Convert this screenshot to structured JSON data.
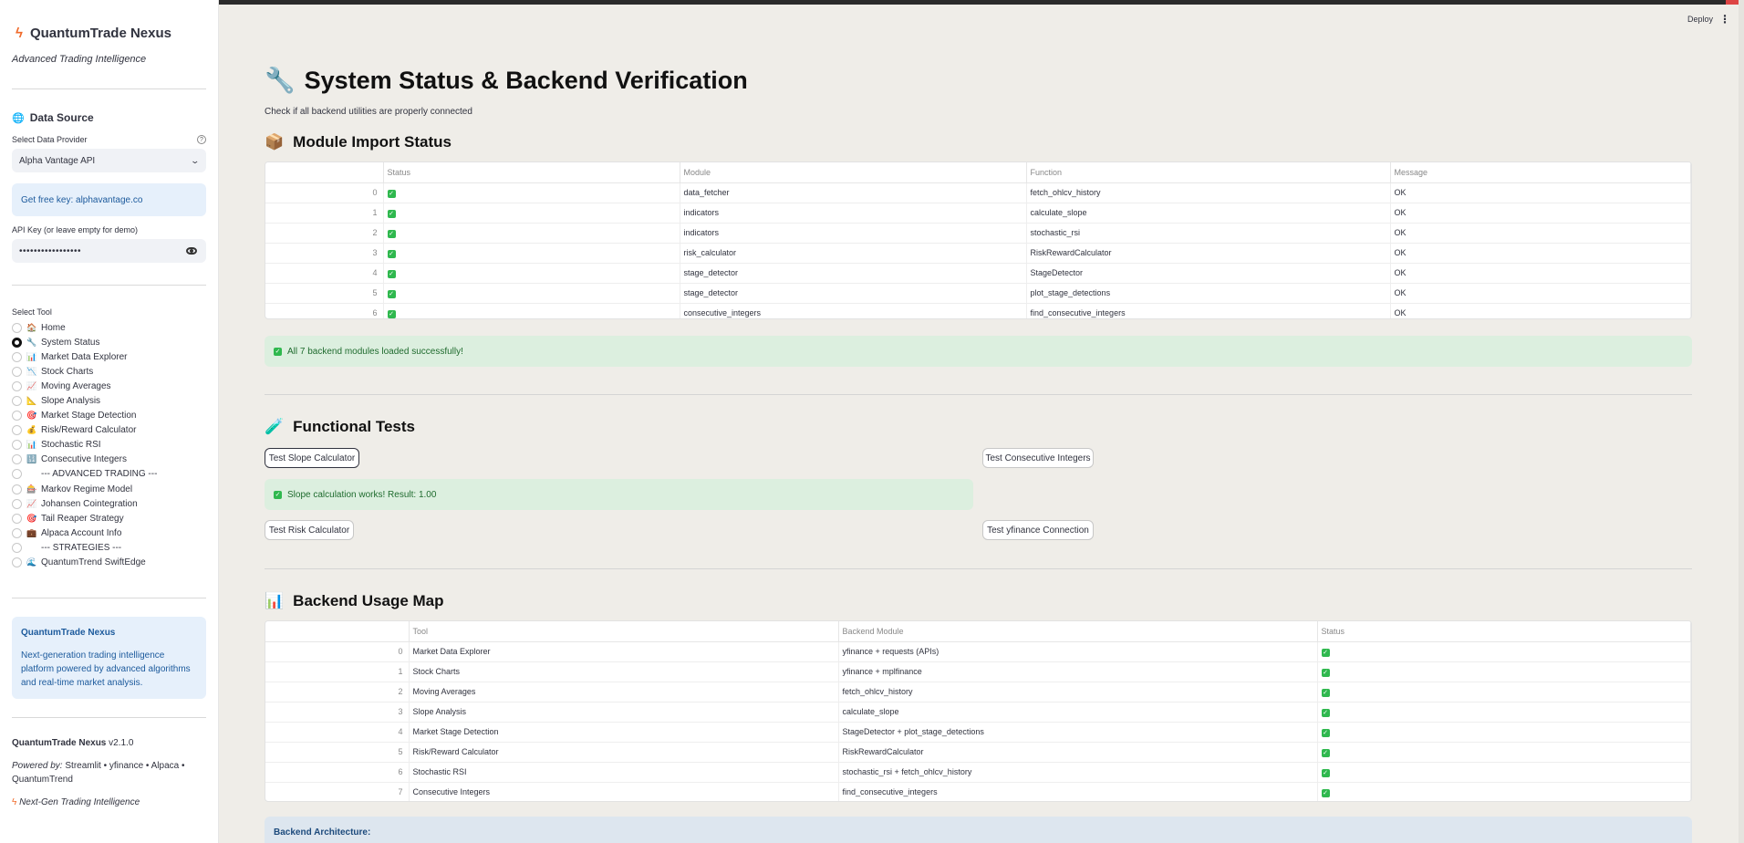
{
  "sidebar": {
    "app_title": "QuantumTrade Nexus",
    "tagline": "Advanced Trading Intelligence",
    "data_source_heading": "Data Source",
    "provider_label": "Select Data Provider",
    "provider_value": "Alpha Vantage API",
    "free_key_text": "Get free key: alphavantage.co",
    "api_key_label": "API Key (or leave empty for demo)",
    "api_key_value": "•••••••••••••••••",
    "select_tool_label": "Select Tool",
    "tools": [
      {
        "icon": "🏠",
        "label": "Home",
        "selected": false
      },
      {
        "icon": "🔧",
        "label": "System Status",
        "selected": true
      },
      {
        "icon": "📊",
        "label": "Market Data Explorer",
        "selected": false
      },
      {
        "icon": "📉",
        "label": "Stock Charts",
        "selected": false
      },
      {
        "icon": "📈",
        "label": "Moving Averages",
        "selected": false
      },
      {
        "icon": "📐",
        "label": "Slope Analysis",
        "selected": false
      },
      {
        "icon": "🎯",
        "label": "Market Stage Detection",
        "selected": false
      },
      {
        "icon": "💰",
        "label": "Risk/Reward Calculator",
        "selected": false
      },
      {
        "icon": "📊",
        "label": "Stochastic RSI",
        "selected": false
      },
      {
        "icon": "🔢",
        "label": "Consecutive Integers",
        "selected": false
      },
      {
        "icon": "",
        "label": "--- ADVANCED TRADING ---",
        "selected": false
      },
      {
        "icon": "🎰",
        "label": "Markov Regime Model",
        "selected": false
      },
      {
        "icon": "📈",
        "label": "Johansen Cointegration",
        "selected": false
      },
      {
        "icon": "🎯",
        "label": "Tail Reaper Strategy",
        "selected": false
      },
      {
        "icon": "💼",
        "label": "Alpaca Account Info",
        "selected": false
      },
      {
        "icon": "",
        "label": "--- STRATEGIES ---",
        "selected": false
      },
      {
        "icon": "🌊",
        "label": "QuantumTrend SwiftEdge",
        "selected": false
      }
    ],
    "about_title": "QuantumTrade Nexus",
    "about_text": "Next-generation trading intelligence platform powered by advanced algorithms and real-time market analysis.",
    "footer_name": "QuantumTrade Nexus",
    "footer_version": "v2.1.0",
    "footer_powered_label": "Powered by:",
    "footer_powered_text": "Streamlit • yfinance • Alpaca • QuantumTrend",
    "footer_tagline": "Next-Gen Trading Intelligence"
  },
  "header": {
    "deploy_label": "Deploy"
  },
  "main": {
    "title": "System Status & Backend Verification",
    "subtitle": "Check if all backend utilities are properly connected",
    "module_heading": "Module Import Status",
    "module_columns": [
      "",
      "Status",
      "Module",
      "Function",
      "Message"
    ],
    "module_rows": [
      {
        "idx": "0",
        "module": "data_fetcher",
        "function": "fetch_ohlcv_history",
        "message": "OK"
      },
      {
        "idx": "1",
        "module": "indicators",
        "function": "calculate_slope",
        "message": "OK"
      },
      {
        "idx": "2",
        "module": "indicators",
        "function": "stochastic_rsi",
        "message": "OK"
      },
      {
        "idx": "3",
        "module": "risk_calculator",
        "function": "RiskRewardCalculator",
        "message": "OK"
      },
      {
        "idx": "4",
        "module": "stage_detector",
        "function": "StageDetector",
        "message": "OK"
      },
      {
        "idx": "5",
        "module": "stage_detector",
        "function": "plot_stage_detections",
        "message": "OK"
      },
      {
        "idx": "6",
        "module": "consecutive_integers",
        "function": "find_consecutive_integers",
        "message": "OK"
      }
    ],
    "modules_success": "All 7 backend modules loaded successfully!",
    "functional_heading": "Functional Tests",
    "btn_slope": "Test Slope Calculator",
    "btn_consecutive": "Test Consecutive Integers",
    "slope_result": "Slope calculation works! Result: 1.00",
    "btn_risk": "Test Risk Calculator",
    "btn_yfinance": "Test yfinance Connection",
    "usage_heading": "Backend Usage Map",
    "usage_columns": [
      "",
      "Tool",
      "Backend Module",
      "Status"
    ],
    "usage_rows": [
      {
        "idx": "0",
        "tool": "Market Data Explorer",
        "backend": "yfinance + requests (APIs)"
      },
      {
        "idx": "1",
        "tool": "Stock Charts",
        "backend": "yfinance + mplfinance"
      },
      {
        "idx": "2",
        "tool": "Moving Averages",
        "backend": "fetch_ohlcv_history"
      },
      {
        "idx": "3",
        "tool": "Slope Analysis",
        "backend": "calculate_slope"
      },
      {
        "idx": "4",
        "tool": "Market Stage Detection",
        "backend": "StageDetector + plot_stage_detections"
      },
      {
        "idx": "5",
        "tool": "Risk/Reward Calculator",
        "backend": "RiskRewardCalculator"
      },
      {
        "idx": "6",
        "tool": "Stochastic RSI",
        "backend": "stochastic_rsi + fetch_ohlcv_history"
      },
      {
        "idx": "7",
        "tool": "Consecutive Integers",
        "backend": "find_consecutive_integers"
      }
    ],
    "architecture_label": "Backend Architecture:"
  },
  "colors": {
    "accent_orange": "#f06a2a",
    "success_green": "#2fb84e",
    "info_blue": "#1c5a9c",
    "sidebar_bg": "#ffffff",
    "main_bg": "#efede8"
  }
}
